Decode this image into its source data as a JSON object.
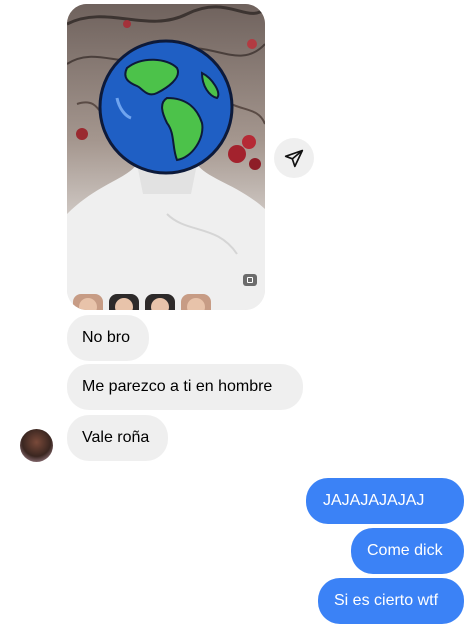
{
  "thread": {
    "incoming": [
      {
        "text": "No bro"
      },
      {
        "text": "Me parezco a ti en hombre"
      },
      {
        "text": "Vale roña"
      }
    ],
    "outgoing": [
      {
        "text": "JAJAJAJAJAJ"
      },
      {
        "text": "Come dick"
      },
      {
        "text": "Si es cierto wtf"
      }
    ]
  },
  "icons": {
    "share": "paper-plane-icon",
    "media_badge": "gallery-icon",
    "sticker": "globe-earth-icon"
  },
  "colors": {
    "outgoing_bubble": "#3b82f6",
    "incoming_bubble": "#efefef"
  }
}
